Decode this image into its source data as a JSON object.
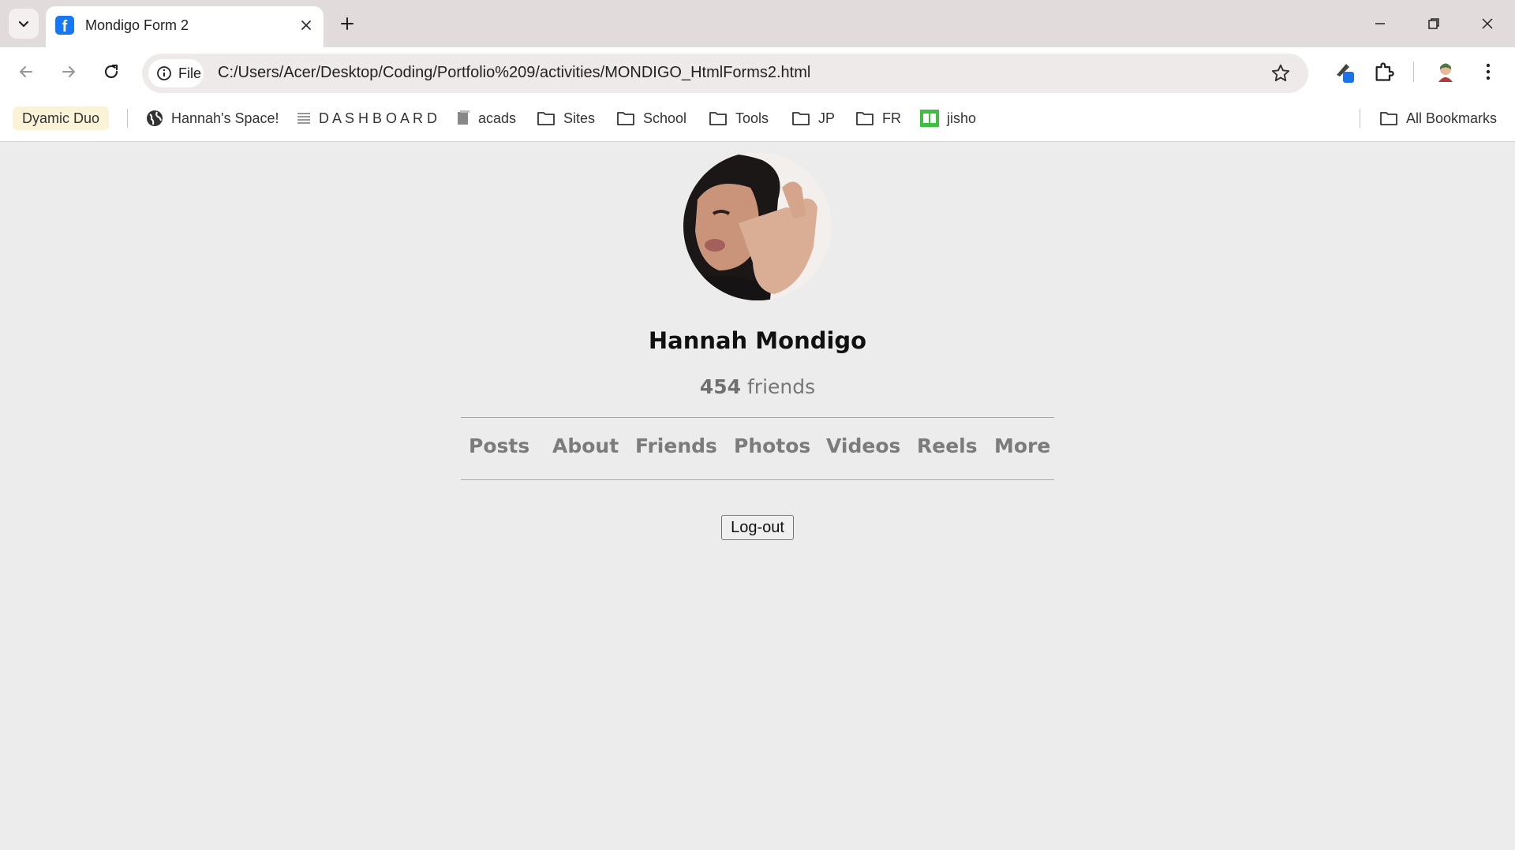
{
  "browser": {
    "tab": {
      "title": "Mondigo Form 2",
      "favicon": "facebook-icon"
    },
    "address_bar": {
      "chip_label": "File",
      "url": "C:/Users/Acer/Desktop/Coding/Portfolio%209/activities/MONDIGO_HtmlForms2.html"
    },
    "bookmarks": [
      {
        "label": "Dyamic Duo",
        "icon": "none"
      },
      {
        "label": "Hannah's Space!",
        "icon": "globe-icon"
      },
      {
        "label": "D A S H B O A R D",
        "icon": "list-icon"
      },
      {
        "label": "acads",
        "icon": "book-icon"
      },
      {
        "label": "Sites",
        "icon": "folder-icon"
      },
      {
        "label": "School",
        "icon": "folder-icon"
      },
      {
        "label": "Tools",
        "icon": "folder-icon"
      },
      {
        "label": "JP",
        "icon": "folder-icon"
      },
      {
        "label": "FR",
        "icon": "folder-icon"
      },
      {
        "label": "jisho",
        "icon": "jisho-icon"
      }
    ],
    "all_bookmarks_label": "All Bookmarks",
    "colors": {
      "tabstrip": "#e2dbdb",
      "omnibox": "#efeaea",
      "accent": "#1a73e8"
    }
  },
  "profile": {
    "name": "Hannah Mondigo",
    "friends_count": "454",
    "friends_label": "friends",
    "nav": [
      "Posts",
      "About",
      "Friends",
      "Photos",
      "Videos",
      "Reels",
      "More"
    ],
    "logout_label": "Log-out"
  }
}
